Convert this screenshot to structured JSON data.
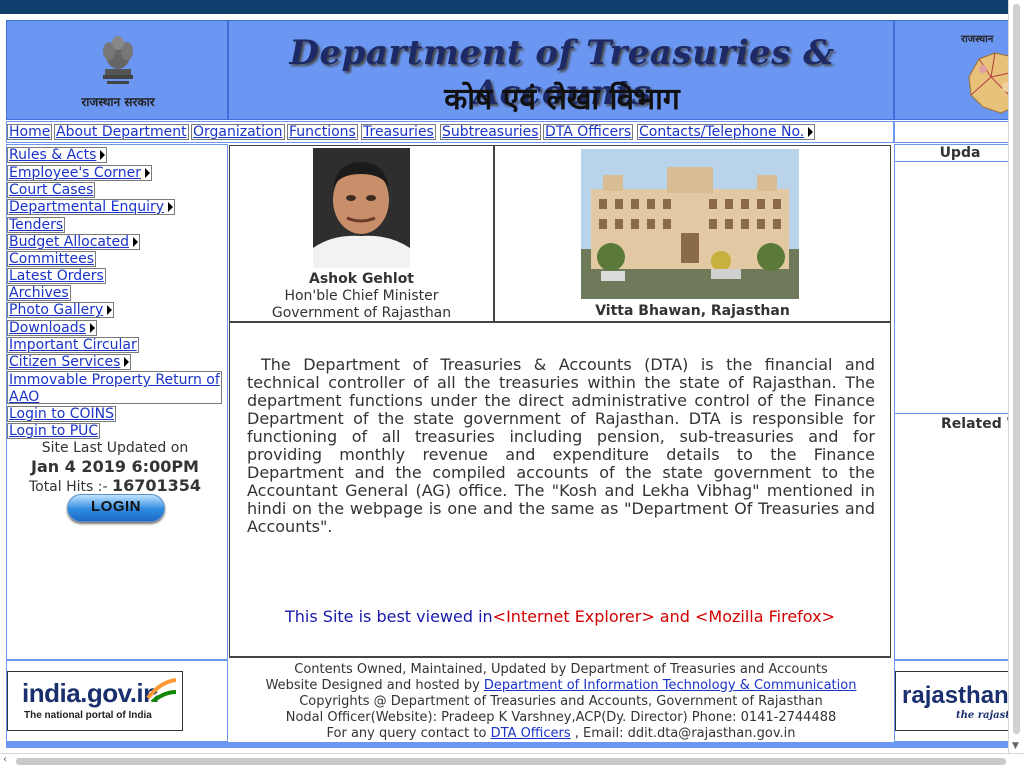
{
  "header": {
    "gov_label": "राजस्थान सरकार",
    "title_en": "Department of Treasuries & Accounts",
    "title_hi": "कोष एवं लेखा विभाग",
    "map_label": "राजस्थान"
  },
  "nav": {
    "items": [
      {
        "label": "Home",
        "arrow": false
      },
      {
        "label": "About Department",
        "arrow": false
      },
      {
        "label": "Organization",
        "arrow": false
      },
      {
        "label": "Functions",
        "arrow": false
      },
      {
        "label": "Treasuries",
        "arrow": false
      },
      {
        "label": "Subtreasuries",
        "arrow": false
      },
      {
        "label": "DTA Officers",
        "arrow": false
      },
      {
        "label": "Contacts/Telephone No.",
        "arrow": true
      }
    ]
  },
  "sidebar": {
    "items": [
      {
        "label": "Rules & Acts",
        "arrow": true
      },
      {
        "label": "Employee's Corner",
        "arrow": true
      },
      {
        "label": "Court Cases",
        "arrow": false
      },
      {
        "label": "Departmental Enquiry",
        "arrow": true
      },
      {
        "label": "Tenders",
        "arrow": false
      },
      {
        "label": "Budget Allocated",
        "arrow": true
      },
      {
        "label": "Committees",
        "arrow": false
      },
      {
        "label": "Latest Orders",
        "arrow": false
      },
      {
        "label": "Archives",
        "arrow": false
      },
      {
        "label": "Photo Gallery",
        "arrow": true
      },
      {
        "label": "Downloads",
        "arrow": true
      },
      {
        "label": "Important Circular",
        "arrow": false
      },
      {
        "label": "Citizen Services",
        "arrow": true
      },
      {
        "label": "Immovable Property Return of AAO",
        "arrow": false
      },
      {
        "label": "Login to COINS",
        "arrow": false
      },
      {
        "label": "Login to PUC",
        "arrow": false
      }
    ],
    "site_updated_label": "Site Last Updated on",
    "site_updated_value": "Jan 4 2019 6:00PM",
    "hits_label": "Total Hits :- ",
    "hits_value": "16701354",
    "login_label": "LOGIN"
  },
  "main": {
    "cm_name": "Ashok Gehlot",
    "cm_role": "Hon'ble Chief Minister",
    "cm_gov": "Government of Rajasthan",
    "building_caption": "Vitta Bhawan, Rajasthan",
    "description": "The Department of Treasuries & Accounts (DTA) is the financial and technical controller of all the treasuries within the state of Rajasthan. The department functions under the direct administrative control of the Finance Department of the state government of Rajasthan. DTA is responsible for functioning of all treasuries including pension, sub-treasuries and for providing monthly revenue and expenditure details to the Finance Department and the compiled accounts of the state government to the Accountant General (AG) office. The \"Kosh and Lekha Vibhag\" mentioned in hindi on the webpage is one and the same as \"Department Of Treasuries and Accounts\".",
    "best_viewed_prefix": "This Site is best viewed in",
    "best_viewed_browsers": "<Internet Explorer> and <Mozilla Firefox>"
  },
  "right": {
    "heading1": "Upda",
    "heading2": "Related W"
  },
  "footer": {
    "line1": "Contents Owned, Maintained, Updated by Department of Treasuries and Accounts",
    "line2_prefix": "Website Designed and hosted by ",
    "line2_link": "Department of Information Technology & Communication",
    "line3": "Copyrights @ Department of Treasuries and Accounts, Government of Rajasthan",
    "line4": "Nodal Officer(Website): Pradeep K Varshney,ACP(Dy. Director) Phone: 0141-2744488",
    "line5_prefix": "For any query contact to ",
    "line5_link": "DTA Officers",
    "line5_suffix": " , Email: ddit.dta@rajasthan.gov.in",
    "indiagov_title": "india.gov.in",
    "indiagov_sub": "The national portal of India",
    "rajasthan_title": "rajasthan",
    "rajasthan_sub": "the rajast"
  },
  "colors": {
    "header_blue": "#6b96f1",
    "link_blue": "#1a33c9",
    "topbar": "#0f3f6d",
    "browser_red": "#d40000"
  }
}
